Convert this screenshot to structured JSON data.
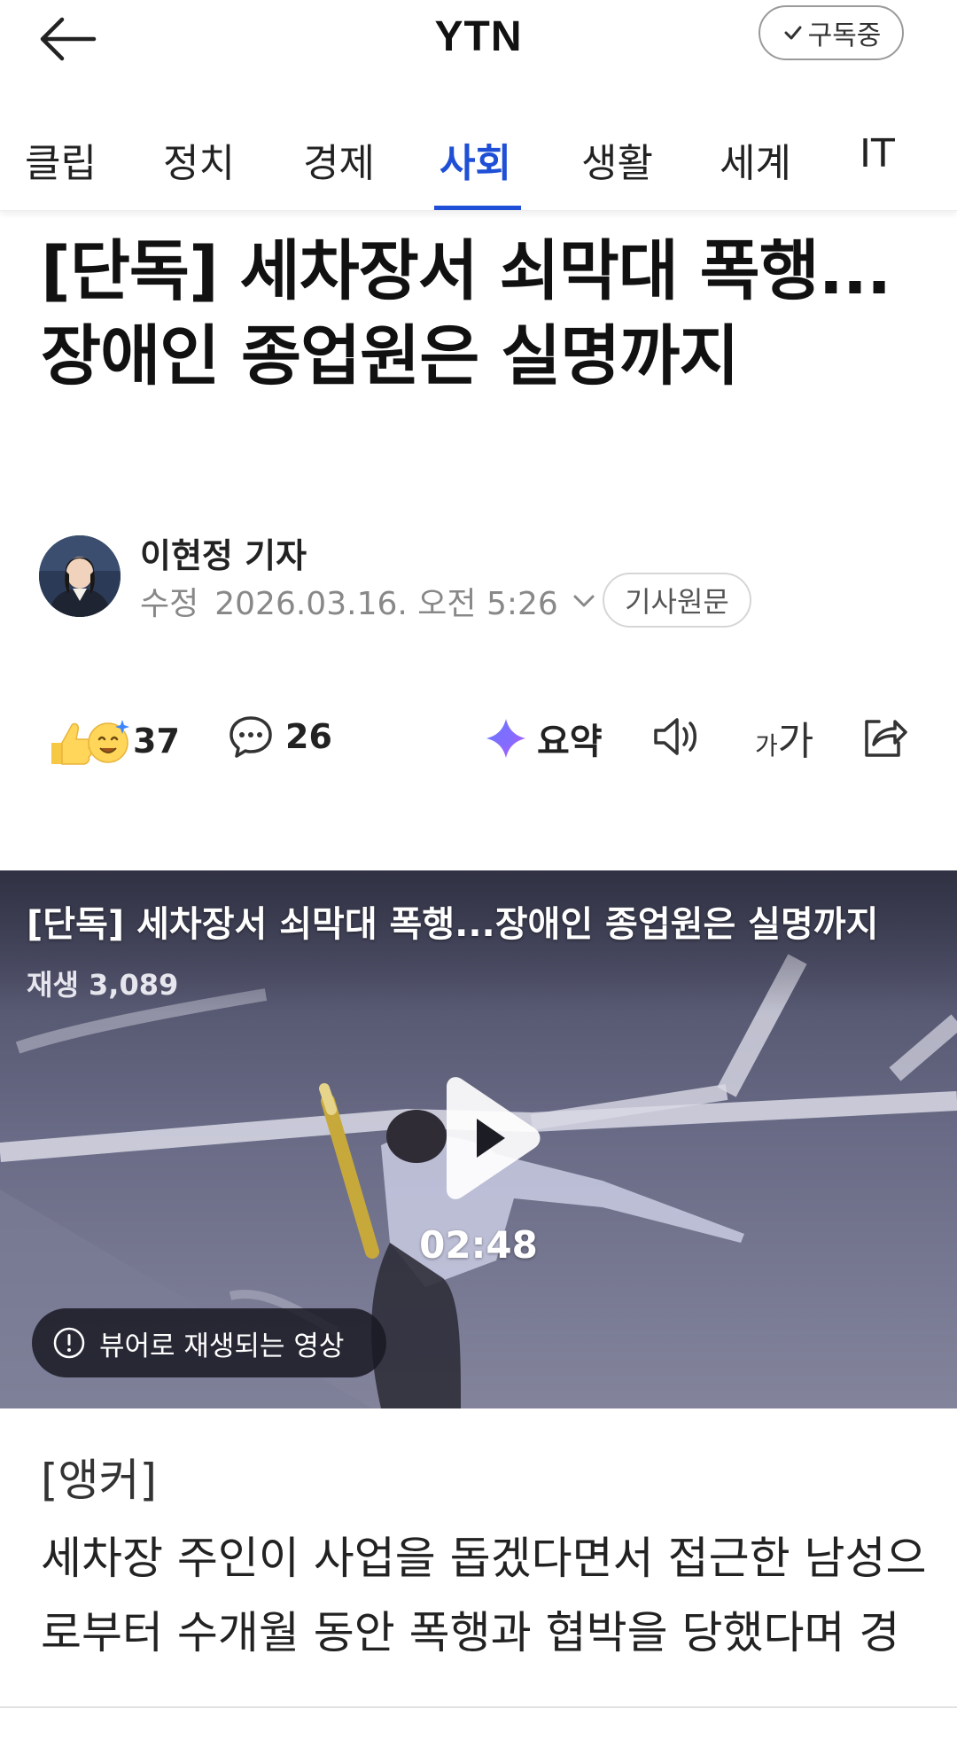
{
  "header": {
    "brand": "YTN",
    "subscribe_label": "구독중"
  },
  "tabs": [
    {
      "label": "클립"
    },
    {
      "label": "정치"
    },
    {
      "label": "경제"
    },
    {
      "label": "사회",
      "active": true
    },
    {
      "label": "생활"
    },
    {
      "label": "세계"
    },
    {
      "label": "IT"
    }
  ],
  "article": {
    "headline": "[단독] 세차장서 쇠막대 폭행...장애인 종업원은 실명까지",
    "reporter": "이현정 기자",
    "date_label": "수정",
    "date_value": "2026.03.16. 오전 5:26",
    "original_button": "기사원문"
  },
  "actions": {
    "reaction_count": "37",
    "comment_count": "26",
    "summary_label": "요약",
    "font_small": "가",
    "font_large": "가"
  },
  "video": {
    "title": "[단독] 세차장서 쇠막대 폭행...장애인 종업원은 실명까지",
    "views": "재생 3,089",
    "duration": "02:48",
    "viewer_note": "뷰어로 재생되는 영상"
  },
  "body": {
    "anchor": "[앵커]",
    "paragraph": "세차장 주인이 사업을 돕겠다면서 접근한 남성으로부터 수개월 동안 폭행과 협박을 당했다며 경찰에 고소했습니다."
  },
  "colors": {
    "accent": "#1f4fd6",
    "text": "#111111",
    "muted": "#888888"
  }
}
